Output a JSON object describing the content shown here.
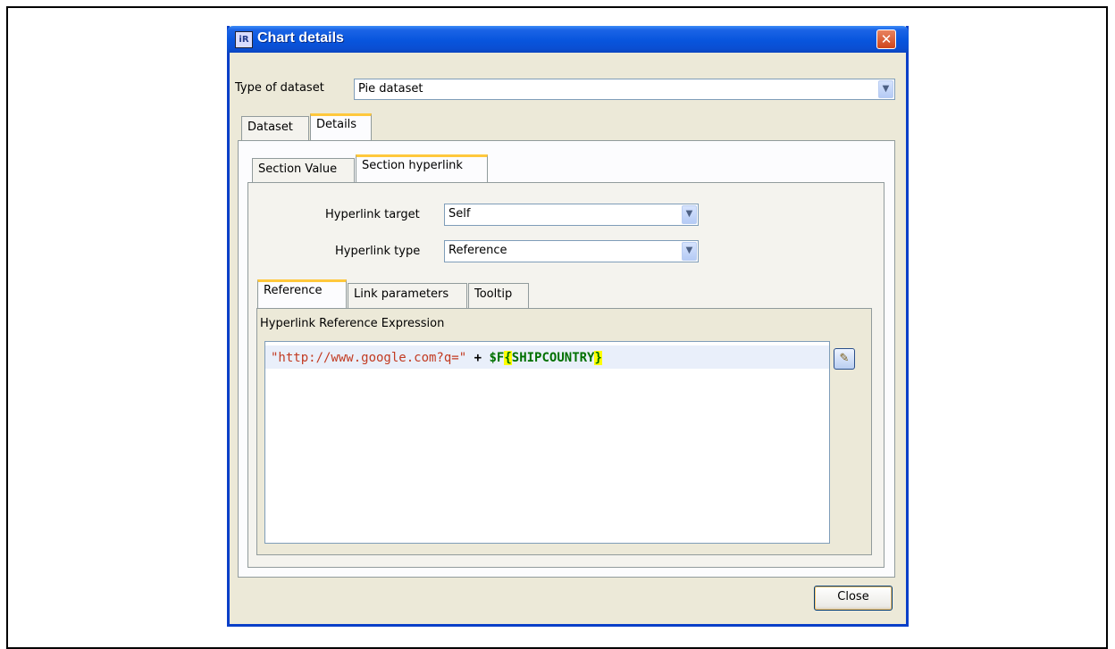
{
  "window": {
    "title": "Chart details",
    "icon": "report-app-icon",
    "icon_glyph": "iR",
    "close_glyph": "✕"
  },
  "dataset_type": {
    "label": "Type of dataset",
    "value": "Pie dataset"
  },
  "outer_tabs": [
    {
      "label": "Dataset",
      "active": false
    },
    {
      "label": "Details",
      "active": true
    }
  ],
  "section_tabs": [
    {
      "label": "Section Value",
      "active": false
    },
    {
      "label": "Section hyperlink",
      "active": true
    }
  ],
  "hyperlink": {
    "target_label": "Hyperlink target",
    "target_value": "Self",
    "type_label": "Hyperlink type",
    "type_value": "Reference"
  },
  "link_tabs": [
    {
      "label": "Reference",
      "active": true
    },
    {
      "label": "Link parameters",
      "active": false
    },
    {
      "label": "Tooltip",
      "active": false
    }
  ],
  "expression": {
    "label": "Hyperlink Reference Expression",
    "string_part": "\"http://www.google.com?q=\"",
    "operator": "+",
    "field_prefix": "$F",
    "open_brace": "{",
    "field_name": "SHIPCOUNTRY",
    "close_brace": "}",
    "edit_icon": "pencil-edit-icon"
  },
  "buttons": {
    "close_label": "Close"
  },
  "colors": {
    "titlebar": "#0855dd",
    "string_token": "#c23b22",
    "field_token": "#007000",
    "brace_highlight": "#ffff00",
    "active_tab_accent": "#ffc83c"
  }
}
